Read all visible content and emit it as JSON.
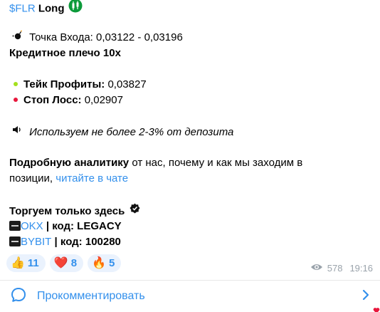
{
  "post": {
    "ticker": "$FLR",
    "direction": "Long",
    "entry_label": "Точка Входа:",
    "entry_value": "0,03122 - 0,03196",
    "leverage": "Кредитное плечо 10х",
    "tp_label": "Тейк Профиты:",
    "tp_value": "0,03827",
    "sl_label": "Стоп Лосс:",
    "sl_value": "0,02907",
    "risk_note": "Используем не более 2-3% от депозита",
    "analytics_bold": "Подробную аналитику",
    "analytics_text_1": " от нас, почему и как мы заходим в",
    "analytics_text_2": "позиции, ",
    "analytics_link": "читайте в чате",
    "trade_here": "Торгуем только здесь",
    "okx_link": "OKX",
    "okx_code": " | код: LEGACY",
    "bybit_link": "BYBIT",
    "bybit_code": " | код: 100280"
  },
  "reactions": [
    {
      "emoji": "👍",
      "count": "11"
    },
    {
      "emoji": "❤️",
      "count": "8"
    },
    {
      "emoji": "🔥",
      "count": "5"
    }
  ],
  "meta": {
    "views": "578",
    "time": "19:16"
  },
  "comments": {
    "label": "Прокомментировать"
  },
  "colors": {
    "link": "#3390ec",
    "tp_dot": "#a4e01c",
    "sl_dot": "#e8173c",
    "reaction_bg": "#eaf2fd",
    "meta": "#9aa3ab"
  },
  "icons": [
    "candlestick-icon",
    "bomb-icon",
    "speaker-icon",
    "verified-badge-icon",
    "okx-logo-icon",
    "bybit-logo-icon",
    "eye-icon",
    "comment-icon",
    "chevron-right-icon"
  ]
}
